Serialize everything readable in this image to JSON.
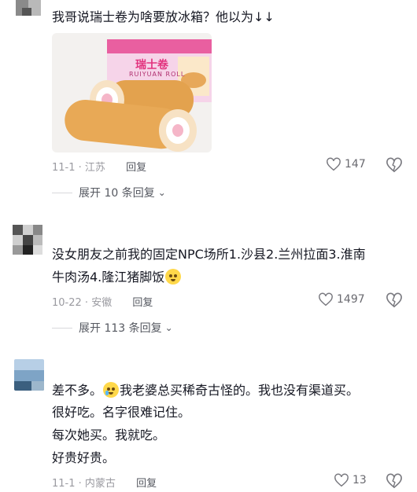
{
  "comments": [
    {
      "text_line1": "我哥说瑞士卷为啥要放冰箱？他以为↓↓",
      "image": {
        "brand_text": "瑞士卷",
        "brand_sub": "RUIYUAN ROLL"
      },
      "date": "11-1",
      "location": "江苏",
      "reply_label": "回复",
      "likes": "147",
      "expand_label": "展开 10 条回复"
    },
    {
      "text_line1": "没女朋友之前我的固定NPC场所1.沙县2.兰州拉面3.淮南",
      "text_line2": "牛肉汤4.隆江猪脚饭",
      "date": "10-22",
      "location": "安徽",
      "reply_label": "回复",
      "likes": "1497",
      "expand_label": "展开 113 条回复"
    },
    {
      "text_line1_a": "差不多。",
      "text_line1_b": "我老婆总买稀奇古怪的。我也没有渠道买。",
      "text_line2": "很好吃。名字很难记住。",
      "text_line3": "每次她买。我就吃。",
      "text_line4": "好贵好贵。",
      "date": "11-1",
      "location": "内蒙古",
      "reply_label": "回复",
      "likes": "13"
    }
  ],
  "colors": {
    "text": "#161823",
    "meta": "#9a9aa0",
    "divider": "#d8d8dc"
  }
}
